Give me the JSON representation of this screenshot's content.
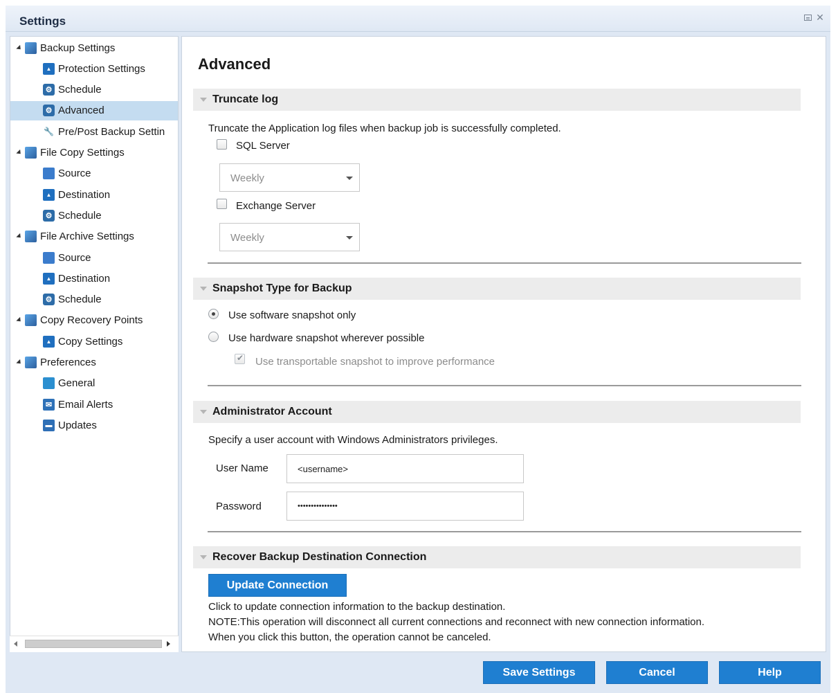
{
  "window": {
    "title": "Settings"
  },
  "tree": {
    "items": [
      {
        "label": "Backup Settings",
        "level": 0,
        "expanded": true,
        "icon": "backup-settings-icon"
      },
      {
        "label": "Protection Settings",
        "level": 1,
        "icon": "protection-icon"
      },
      {
        "label": "Schedule",
        "level": 1,
        "icon": "schedule-icon"
      },
      {
        "label": "Advanced",
        "level": 1,
        "selected": true,
        "icon": "advanced-icon"
      },
      {
        "label": "Pre/Post Backup Settin",
        "level": 1,
        "icon": "wrench-icon"
      },
      {
        "label": "File Copy Settings",
        "level": 0,
        "expanded": true,
        "icon": "file-copy-icon"
      },
      {
        "label": "Source",
        "level": 1,
        "icon": "source-icon"
      },
      {
        "label": "Destination",
        "level": 1,
        "icon": "destination-icon"
      },
      {
        "label": "Schedule",
        "level": 1,
        "icon": "schedule-icon"
      },
      {
        "label": "File Archive Settings",
        "level": 0,
        "expanded": true,
        "icon": "file-archive-icon"
      },
      {
        "label": "Source",
        "level": 1,
        "icon": "source-icon"
      },
      {
        "label": "Destination",
        "level": 1,
        "icon": "destination-icon"
      },
      {
        "label": "Schedule",
        "level": 1,
        "icon": "schedule-icon"
      },
      {
        "label": "Copy Recovery Points",
        "level": 0,
        "expanded": true,
        "icon": "copy-recovery-icon"
      },
      {
        "label": "Copy Settings",
        "level": 1,
        "icon": "copy-settings-icon"
      },
      {
        "label": "Preferences",
        "level": 0,
        "expanded": true,
        "icon": "preferences-icon"
      },
      {
        "label": "General",
        "level": 1,
        "icon": "general-icon"
      },
      {
        "label": "Email Alerts",
        "level": 1,
        "icon": "email-icon"
      },
      {
        "label": "Updates",
        "level": 1,
        "icon": "updates-icon"
      }
    ]
  },
  "content": {
    "page_title": "Advanced",
    "truncate": {
      "header": "Truncate log",
      "description": "Truncate the Application log files when backup job is successfully completed.",
      "sql_label": "SQL Server",
      "sql_checked": false,
      "sql_frequency": "Weekly",
      "exchange_label": "Exchange Server",
      "exchange_checked": false,
      "exchange_frequency": "Weekly"
    },
    "snapshot": {
      "header": "Snapshot Type for Backup",
      "software_label": "Use software snapshot only",
      "software_selected": true,
      "hardware_label": "Use hardware snapshot wherever possible",
      "hardware_selected": false,
      "transportable_label": "Use transportable snapshot to improve performance",
      "transportable_checked": true,
      "transportable_disabled": true
    },
    "admin": {
      "header": "Administrator Account",
      "description": "Specify a user account with Windows Administrators privileges.",
      "username_label": "User Name",
      "username_value": "<username>",
      "password_label": "Password",
      "password_value": "•••••••••••••••"
    },
    "recover": {
      "header": "Recover Backup Destination Connection",
      "button_label": "Update Connection",
      "line1": "Click to update connection information to the backup destination.",
      "line2": "NOTE:This operation will disconnect all current connections and reconnect with new connection information.",
      "line3": "When you click this button, the operation cannot be canceled."
    }
  },
  "footer": {
    "save_label": "Save Settings",
    "cancel_label": "Cancel",
    "help_label": "Help"
  },
  "colors": {
    "accent_button": "#1f7fd1",
    "selection": "#c4dcf0",
    "frame": "#dfe8f4"
  }
}
